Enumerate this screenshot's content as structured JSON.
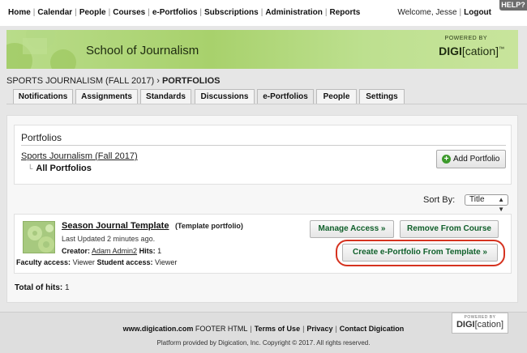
{
  "nav": {
    "links": [
      "Home",
      "Calendar",
      "People",
      "Courses",
      "e-Portfolios",
      "Subscriptions",
      "Administration",
      "Reports"
    ],
    "welcome": "Welcome, Jesse",
    "logout": "Logout",
    "help": "HELP?"
  },
  "banner": {
    "school": "School of Journalism",
    "powered_by": "POWERED BY",
    "logo_bold": "DIGI",
    "logo_rest": "[cation]",
    "logo_tm": "™"
  },
  "breadcrumb": {
    "course": "SPORTS JOURNALISM (FALL 2017)",
    "separator": "›",
    "current": "PORTFOLIOS"
  },
  "tabs": [
    {
      "label": "Notifications",
      "active": false
    },
    {
      "label": "Assignments",
      "active": false
    },
    {
      "label": "Standards",
      "active": false
    },
    {
      "label": "Discussions",
      "active": false
    },
    {
      "label": "e-Portfolios",
      "active": true
    },
    {
      "label": "People",
      "active": false
    },
    {
      "label": "Settings",
      "active": false
    }
  ],
  "portfolios": {
    "heading": "Portfolios",
    "course_link": "Sports Journalism (Fall 2017)",
    "all_portfolios": "All Portfolios",
    "add_button": "Add Portfolio"
  },
  "sort": {
    "label": "Sort By:",
    "selected": "Title"
  },
  "template": {
    "title": "Season Journal Template",
    "type": "(Template portfolio)",
    "updated": "Last Updated 2 minutes ago.",
    "creator_label": "Creator:",
    "creator_name": "Adam Admin2",
    "hits_label": "Hits:",
    "hits_value": "1",
    "faculty_label": "Faculty access:",
    "faculty_value": "Viewer",
    "student_label": "Student access:",
    "student_value": "Viewer",
    "manage_button": "Manage Access »",
    "remove_button": "Remove From Course",
    "create_button": "Create e-Portfolio From Template »"
  },
  "total": {
    "label": "Total of hits:",
    "value": "1"
  },
  "footer": {
    "site": "www.digication.com",
    "footer_html": "FOOTER HTML",
    "terms": "Terms of Use",
    "privacy": "Privacy",
    "contact": "Contact Digication",
    "copyright": "Platform provided by Digication, Inc. Copyright © 2017. All rights reserved.",
    "logo_powered": "POWERED BY",
    "logo_bold": "DIGI",
    "logo_rest": "[cation]"
  },
  "colors": {
    "banner_green": "#a8d16c",
    "button_text_green": "#0f5f2a",
    "highlight_red": "#d5321f",
    "plus_green": "#3d9a2c"
  }
}
